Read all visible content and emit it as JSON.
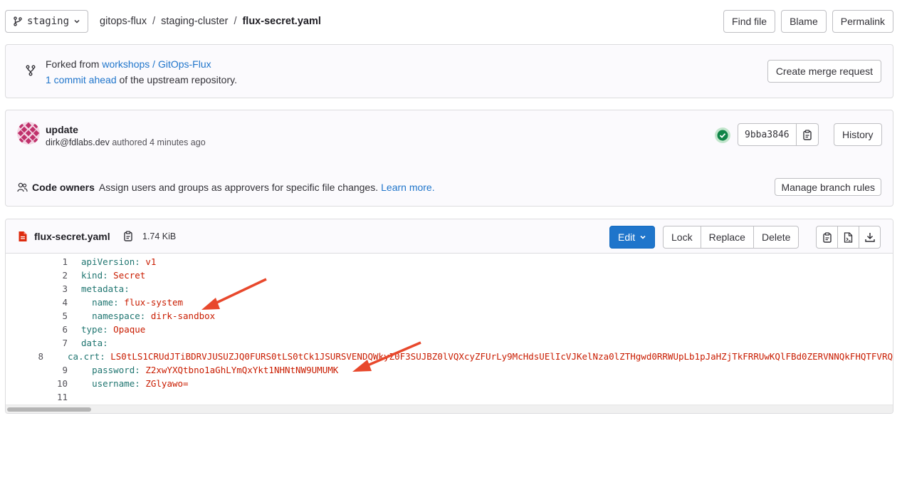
{
  "branch": {
    "name": "staging"
  },
  "breadcrumb": {
    "project": "gitops-flux",
    "folder": "staging-cluster",
    "file": "flux-secret.yaml",
    "sep": "/"
  },
  "top_actions": {
    "find_file": "Find file",
    "blame": "Blame",
    "permalink": "Permalink"
  },
  "fork": {
    "prefix": "Forked from",
    "source_link": "workshops / GitOps-Flux",
    "ahead_link": "1 commit ahead",
    "ahead_suffix": "of the upstream repository.",
    "merge_button": "Create merge request"
  },
  "commit": {
    "title": "update",
    "author": "dirk@fdlabs.dev",
    "authored": "authored 4 minutes ago",
    "sha": "9bba3846",
    "history_button": "History"
  },
  "code_owners": {
    "label": "Code owners",
    "text": "Assign users and groups as approvers for specific file changes.",
    "learn_more": "Learn more.",
    "manage_button": "Manage branch rules"
  },
  "file": {
    "name": "flux-secret.yaml",
    "size": "1.74 KiB",
    "edit_button": "Edit",
    "lock_button": "Lock",
    "replace_button": "Replace",
    "delete_button": "Delete"
  },
  "code_lines": [
    {
      "n": "1",
      "indent": "",
      "key": "apiVersion",
      "value": "v1"
    },
    {
      "n": "2",
      "indent": "",
      "key": "kind",
      "value": "Secret"
    },
    {
      "n": "3",
      "indent": "",
      "key": "metadata",
      "value": ""
    },
    {
      "n": "4",
      "indent": "  ",
      "key": "name",
      "value": "flux-system"
    },
    {
      "n": "5",
      "indent": "  ",
      "key": "namespace",
      "value": "dirk-sandbox"
    },
    {
      "n": "6",
      "indent": "",
      "key": "type",
      "value": "Opaque"
    },
    {
      "n": "7",
      "indent": "",
      "key": "data",
      "value": ""
    },
    {
      "n": "8",
      "indent": "  ",
      "key": "ca.crt",
      "value": "LS0tLS1CRUdJTiBDRVJUSUZJQ0FURS0tLS0tCk1JSURSVENDQWkyZ0F3SUJBZ0lVQXcyZFUrLy9McHdsUElIcVJKelNza0lZTHgwd0RRWUpLb1pJaHZjTkFRRUwKQlFBd0ZERVNNQkFHQTFVRQ"
    },
    {
      "n": "9",
      "indent": "  ",
      "key": "password",
      "value": "Z2xwYXQtbno1aGhLYmQxYkt1NHNtNW9UMUMK"
    },
    {
      "n": "10",
      "indent": "  ",
      "key": "username",
      "value": "ZGlyawo="
    },
    {
      "n": "11",
      "indent": "",
      "key": "",
      "value": ""
    }
  ],
  "colors": {
    "accent": "#1f75cb",
    "yaml_key": "#1f7570",
    "yaml_value": "#c91c00",
    "annotation_arrow": "#e8482c",
    "success": "#108548"
  },
  "icons": [
    "branch-icon",
    "chevron-down-icon",
    "fork-icon",
    "avatar",
    "check-circle-icon",
    "copy-icon",
    "users-icon",
    "file-icon",
    "raw-file-icon",
    "download-icon"
  ]
}
